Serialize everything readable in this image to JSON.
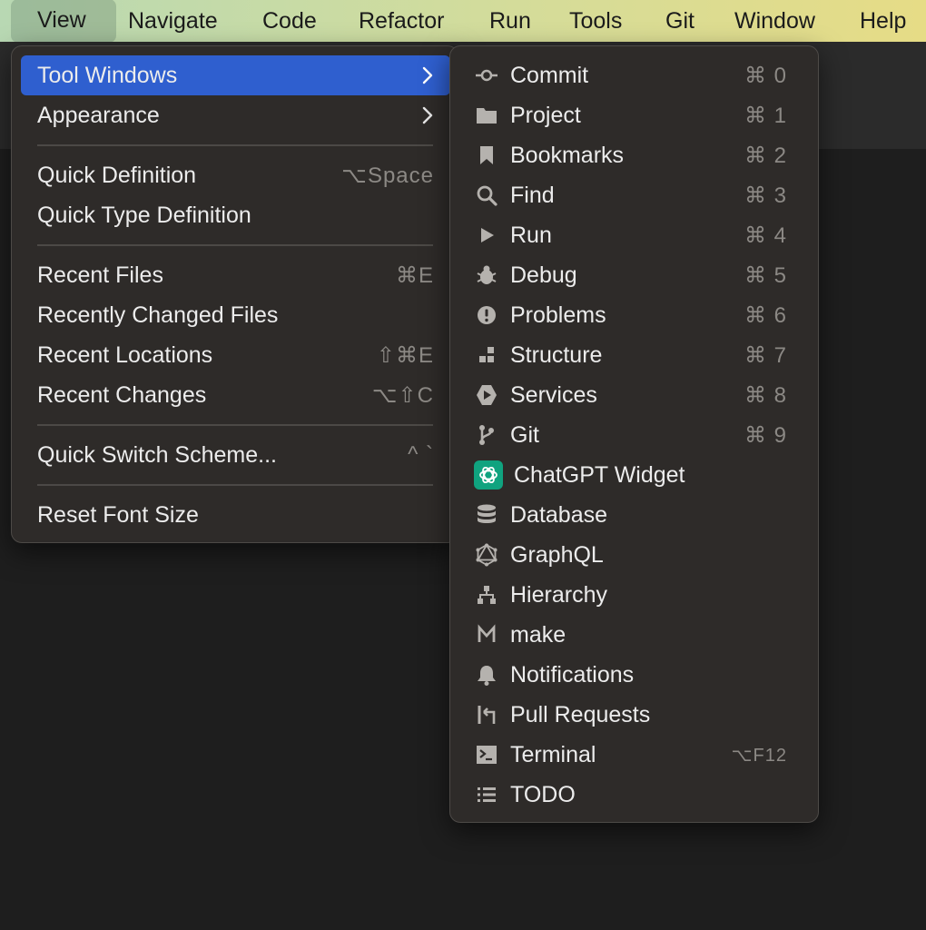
{
  "menubar": {
    "items": [
      "View",
      "Navigate",
      "Code",
      "Refactor",
      "Run",
      "Tools",
      "Git",
      "Window",
      "Help"
    ]
  },
  "view_menu": {
    "items": [
      {
        "label": "Tool Windows",
        "shortcut": ""
      },
      {
        "label": "Appearance",
        "shortcut": ""
      },
      {
        "label": "Quick Definition",
        "shortcut": "⌥Space"
      },
      {
        "label": "Quick Type Definition",
        "shortcut": ""
      },
      {
        "label": "Recent Files",
        "shortcut": "⌘E"
      },
      {
        "label": "Recently Changed Files",
        "shortcut": ""
      },
      {
        "label": "Recent Locations",
        "shortcut": "⇧⌘E"
      },
      {
        "label": "Recent Changes",
        "shortcut": "⌥⇧C"
      },
      {
        "label": "Quick Switch Scheme...",
        "shortcut": "^ `"
      },
      {
        "label": "Reset Font Size",
        "shortcut": ""
      }
    ]
  },
  "tool_windows_menu": {
    "items": [
      {
        "label": "Commit",
        "shortcut": "⌘ 0",
        "icon": "commit-icon"
      },
      {
        "label": "Project",
        "shortcut": "⌘ 1",
        "icon": "folder-icon"
      },
      {
        "label": "Bookmarks",
        "shortcut": "⌘ 2",
        "icon": "bookmark-icon"
      },
      {
        "label": "Find",
        "shortcut": "⌘ 3",
        "icon": "search-icon"
      },
      {
        "label": "Run",
        "shortcut": "⌘ 4",
        "icon": "play-icon"
      },
      {
        "label": "Debug",
        "shortcut": "⌘ 5",
        "icon": "bug-icon"
      },
      {
        "label": "Problems",
        "shortcut": "⌘ 6",
        "icon": "exclamation-icon"
      },
      {
        "label": "Structure",
        "shortcut": "⌘ 7",
        "icon": "structure-icon"
      },
      {
        "label": "Services",
        "shortcut": "⌘ 8",
        "icon": "services-icon"
      },
      {
        "label": "Git",
        "shortcut": "⌘ 9",
        "icon": "git-branch-icon"
      },
      {
        "label": "ChatGPT Widget",
        "shortcut": "",
        "icon": "chatgpt-icon"
      },
      {
        "label": "Database",
        "shortcut": "",
        "icon": "database-icon"
      },
      {
        "label": "GraphQL",
        "shortcut": "",
        "icon": "graphql-icon"
      },
      {
        "label": "Hierarchy",
        "shortcut": "",
        "icon": "hierarchy-icon"
      },
      {
        "label": "make",
        "shortcut": "",
        "icon": "make-icon"
      },
      {
        "label": "Notifications",
        "shortcut": "",
        "icon": "bell-icon"
      },
      {
        "label": "Pull Requests",
        "shortcut": "",
        "icon": "pull-request-icon"
      },
      {
        "label": "Terminal",
        "shortcut": "⌥F12",
        "icon": "terminal-icon"
      },
      {
        "label": "TODO",
        "shortcut": "",
        "icon": "todo-list-icon"
      }
    ]
  },
  "colors": {
    "menu_bg": "#2e2b29",
    "selection": "#2f5fcf",
    "chatgpt_green": "#10a37f",
    "icon_gray": "#b5b2ae"
  }
}
